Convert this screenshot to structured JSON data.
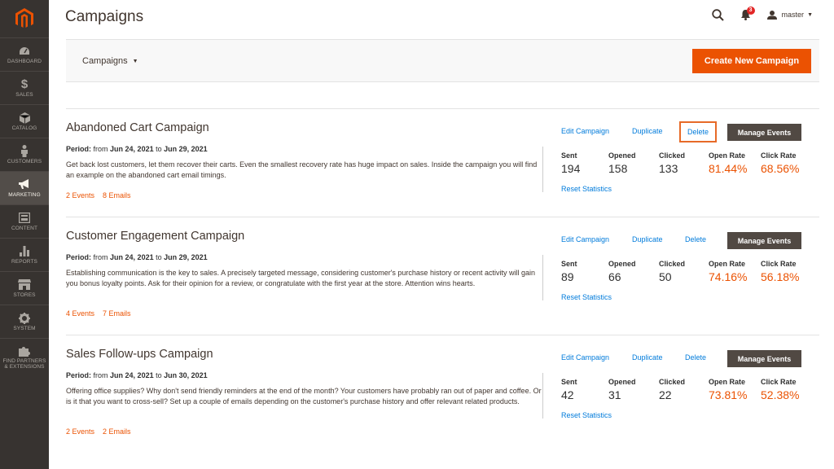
{
  "sidebar": {
    "logo": "magento-logo",
    "items": [
      {
        "label": "DASHBOARD",
        "icon": "dashboard-icon"
      },
      {
        "label": "SALES",
        "icon": "dollar-icon"
      },
      {
        "label": "CATALOG",
        "icon": "cube-icon"
      },
      {
        "label": "CUSTOMERS",
        "icon": "person-icon"
      },
      {
        "label": "MARKETING",
        "icon": "megaphone-icon",
        "active": true
      },
      {
        "label": "CONTENT",
        "icon": "layout-icon"
      },
      {
        "label": "REPORTS",
        "icon": "bar-chart-icon"
      },
      {
        "label": "STORES",
        "icon": "store-icon"
      },
      {
        "label": "SYSTEM",
        "icon": "gear-icon"
      },
      {
        "label": "FIND PARTNERS\n& EXTENSIONS",
        "icon": "puzzle-icon"
      }
    ]
  },
  "header": {
    "title": "Campaigns",
    "notification_count": "3",
    "user_name": "master"
  },
  "toolbar": {
    "switcher_label": "Campaigns",
    "create_label": "Create New Campaign"
  },
  "actions": {
    "edit": "Edit Campaign",
    "duplicate": "Duplicate",
    "delete": "Delete",
    "manage": "Manage Events",
    "reset": "Reset Statistics"
  },
  "stat_labels": {
    "sent": "Sent",
    "opened": "Opened",
    "clicked": "Clicked",
    "open_rate": "Open Rate",
    "click_rate": "Click Rate"
  },
  "period_labels": {
    "period": "Period:",
    "from": "from",
    "to": "to"
  },
  "campaigns": [
    {
      "title": "Abandoned Cart Campaign",
      "period_from": "Jun 24, 2021",
      "period_to": "Jun 29, 2021",
      "description": "Get back lost customers, let them recover their carts. Even the smallest recovery rate has huge impact on sales. Inside the campaign you will find an example on the abandoned cart email timings.",
      "events": "2 Events",
      "emails": "8 Emails",
      "sent": "194",
      "opened": "158",
      "clicked": "133",
      "open_rate": "81.44%",
      "click_rate": "68.56%"
    },
    {
      "title": "Customer Engagement Campaign",
      "period_from": "Jun 24, 2021",
      "period_to": "Jun 29, 2021",
      "description": "Establishing communication is the key to sales. A precisely targeted message, considering customer's purchase history or recent activity will gain you bonus loyalty points. Ask for their opinion for a review, or congratulate with the first year at the store. Attention wins hearts.",
      "events": "4 Events",
      "emails": "7 Emails",
      "sent": "89",
      "opened": "66",
      "clicked": "50",
      "open_rate": "74.16%",
      "click_rate": "56.18%"
    },
    {
      "title": "Sales Follow-ups Campaign",
      "period_from": "Jun 24, 2021",
      "period_to": "Jun 30, 2021",
      "description": "Offering office supplies? Why don't send friendly reminders at the end of the month? Your customers have probably ran out of paper and coffee. Or is it that you want to cross-sell? Set up a couple of emails depending on the customer's purchase history and offer relevant related products.",
      "events": "2 Events",
      "emails": "2 Emails",
      "sent": "42",
      "opened": "31",
      "clicked": "22",
      "open_rate": "73.81%",
      "click_rate": "52.38%"
    }
  ],
  "colors": {
    "accent": "#eb5202",
    "link": "#007bdb",
    "sidebar": "#373330",
    "highlight_border": "#e76a28"
  }
}
